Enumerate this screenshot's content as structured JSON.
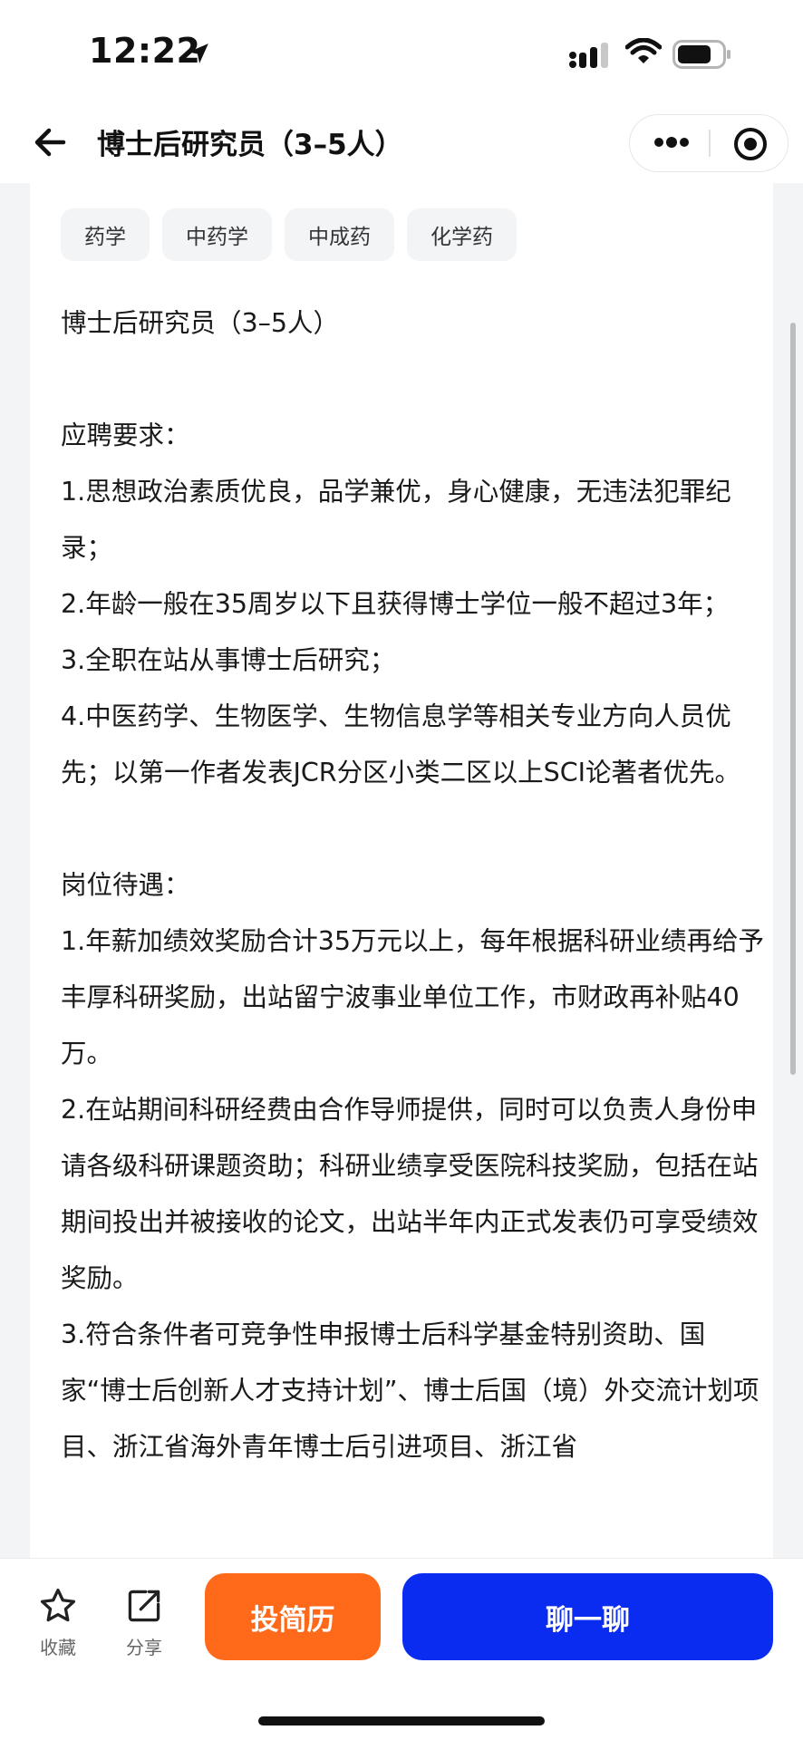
{
  "status_bar": {
    "time": "12:22"
  },
  "nav": {
    "title": "博士后研究员（3–5人）"
  },
  "tags": [
    "药学",
    "中药学",
    "中成药",
    "化学药"
  ],
  "description": "博士后研究员（3–5人）\n\n应聘要求：\n1.思想政治素质优良，品学兼优，身心健康，无违法犯罪纪录；\n2.年龄一般在35周岁以下且获得博士学位一般不超过3年；\n3.全职在站从事博士后研究；\n4.中医药学、生物医学、生物信息学等相关专业方向人员优先；以第一作者发表JCR分区小类二区以上SCI论著者优先。\n\n岗位待遇：\n1.年薪加绩效奖励合计35万元以上，每年根据科研业绩再给予丰厚科研奖励，出站留宁波事业单位工作，市财政再补贴40万。\n2.在站期间科研经费由合作导师提供，同时可以负责人身份申请各级科研课题资助；科研业绩享受医院科技奖励，包括在站期间投出并被接收的论文，出站半年内正式发表仍可享受绩效奖励。\n3.符合条件者可竞争性申报博士后科学基金特别资助、国家“博士后创新人才支持计划”、博士后国（境）外交流计划项目、浙江省海外青年博士后引进项目、浙江省",
  "bottom_bar": {
    "favorite_label": "收藏",
    "share_label": "分享",
    "apply_label": "投简历",
    "chat_label": "聊一聊"
  },
  "colors": {
    "apply_button": "#ff6a1a",
    "chat_button": "#0a2cf0",
    "tag_background": "#f3f4f6"
  }
}
